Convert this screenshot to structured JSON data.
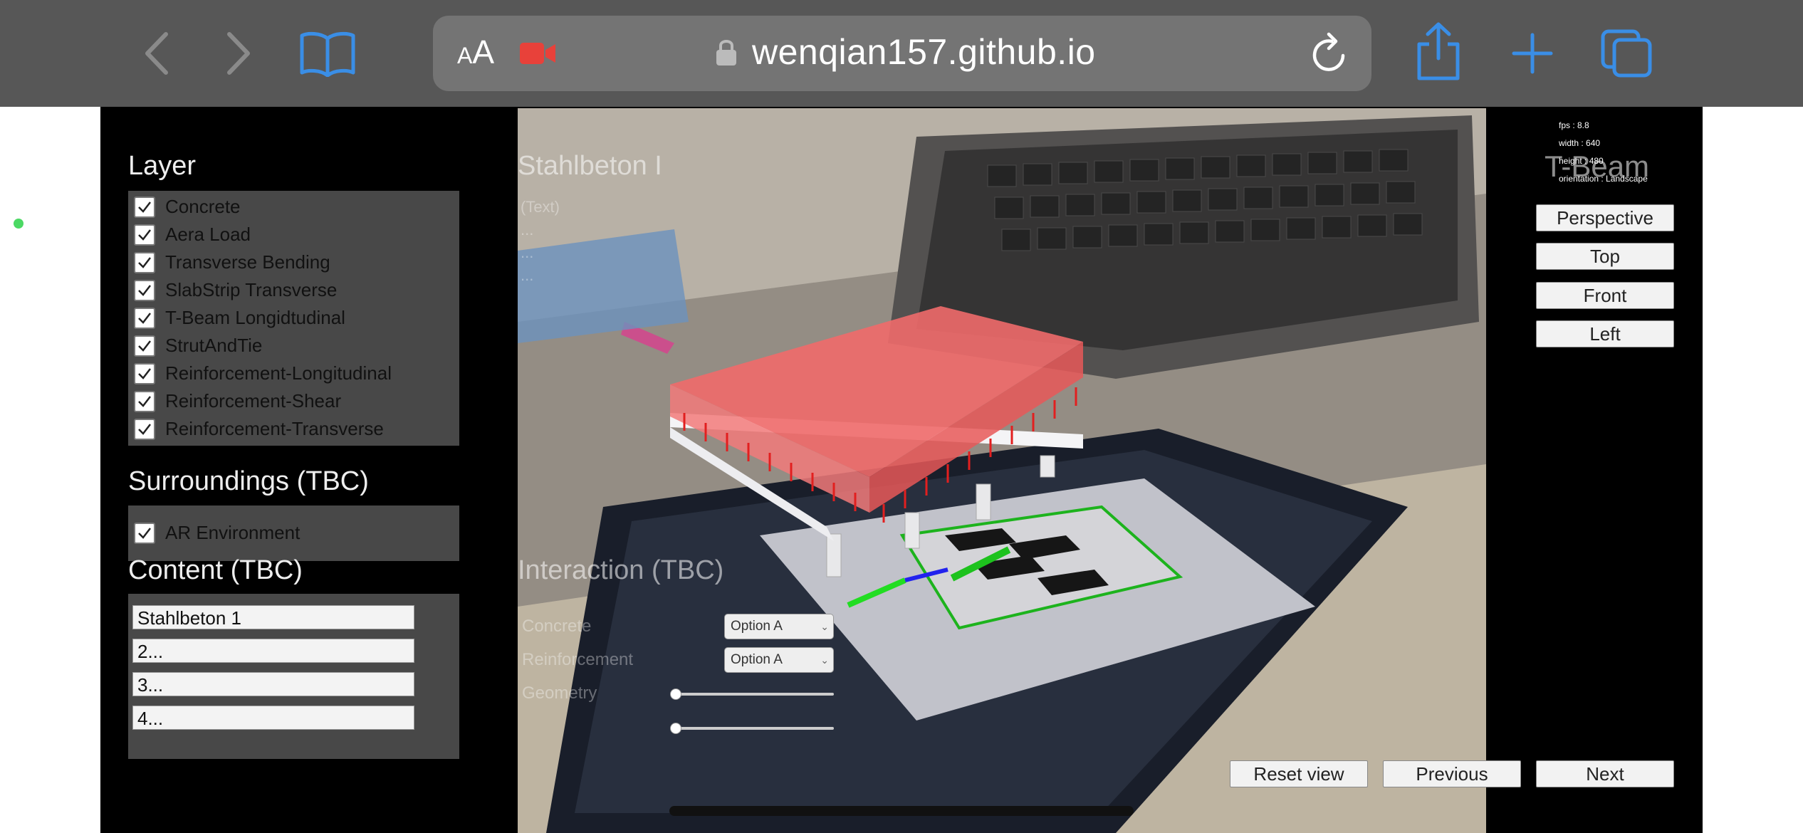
{
  "browser": {
    "url": "wenqian157.github.io",
    "text_size_label": "AA"
  },
  "layer_panel": {
    "title": "Layer",
    "items": [
      {
        "label": "Concrete",
        "checked": true
      },
      {
        "label": "Aera Load",
        "checked": true
      },
      {
        "label": "Transverse Bending",
        "checked": true
      },
      {
        "label": "SlabStrip Transverse",
        "checked": true
      },
      {
        "label": "T-Beam Longidtudinal",
        "checked": true
      },
      {
        "label": "StrutAndTie",
        "checked": true
      },
      {
        "label": "Reinforcement-Longitudinal",
        "checked": true
      },
      {
        "label": "Reinforcement-Shear",
        "checked": true
      },
      {
        "label": "Reinforcement-Transverse",
        "checked": true
      }
    ]
  },
  "surroundings_panel": {
    "title": "Surroundings (TBC)",
    "items": [
      {
        "label": "AR Environment",
        "checked": true
      }
    ]
  },
  "content_panel": {
    "title": "Content (TBC)",
    "inputs": [
      "Stahlbeton 1",
      "2...",
      "3...",
      "4..."
    ]
  },
  "overlay": {
    "title": "Stahlbeton I",
    "lines": [
      "(Text)",
      "...",
      "...",
      "..."
    ]
  },
  "interaction_panel": {
    "title": "Interaction (TBC)",
    "concrete_label": "Concrete",
    "concrete_value": "Option A",
    "reinforcement_label": "Reinforcement",
    "reinforcement_value": "Option A",
    "geometry_label": "Geometry"
  },
  "stats": {
    "fps": "fps : 8.8",
    "width": "width : 640",
    "height": "height : 480",
    "orientation": "orientation : Landscape"
  },
  "model_title": "T-Beam",
  "view_buttons": [
    "Perspective",
    "Top",
    "Front",
    "Left"
  ],
  "nav_buttons": {
    "reset": "Reset view",
    "previous": "Previous",
    "next": "Next"
  },
  "colors": {
    "accent_blue": "#3a8ee6",
    "slab_red": "#f06a6a",
    "record_red": "#e8413a"
  }
}
